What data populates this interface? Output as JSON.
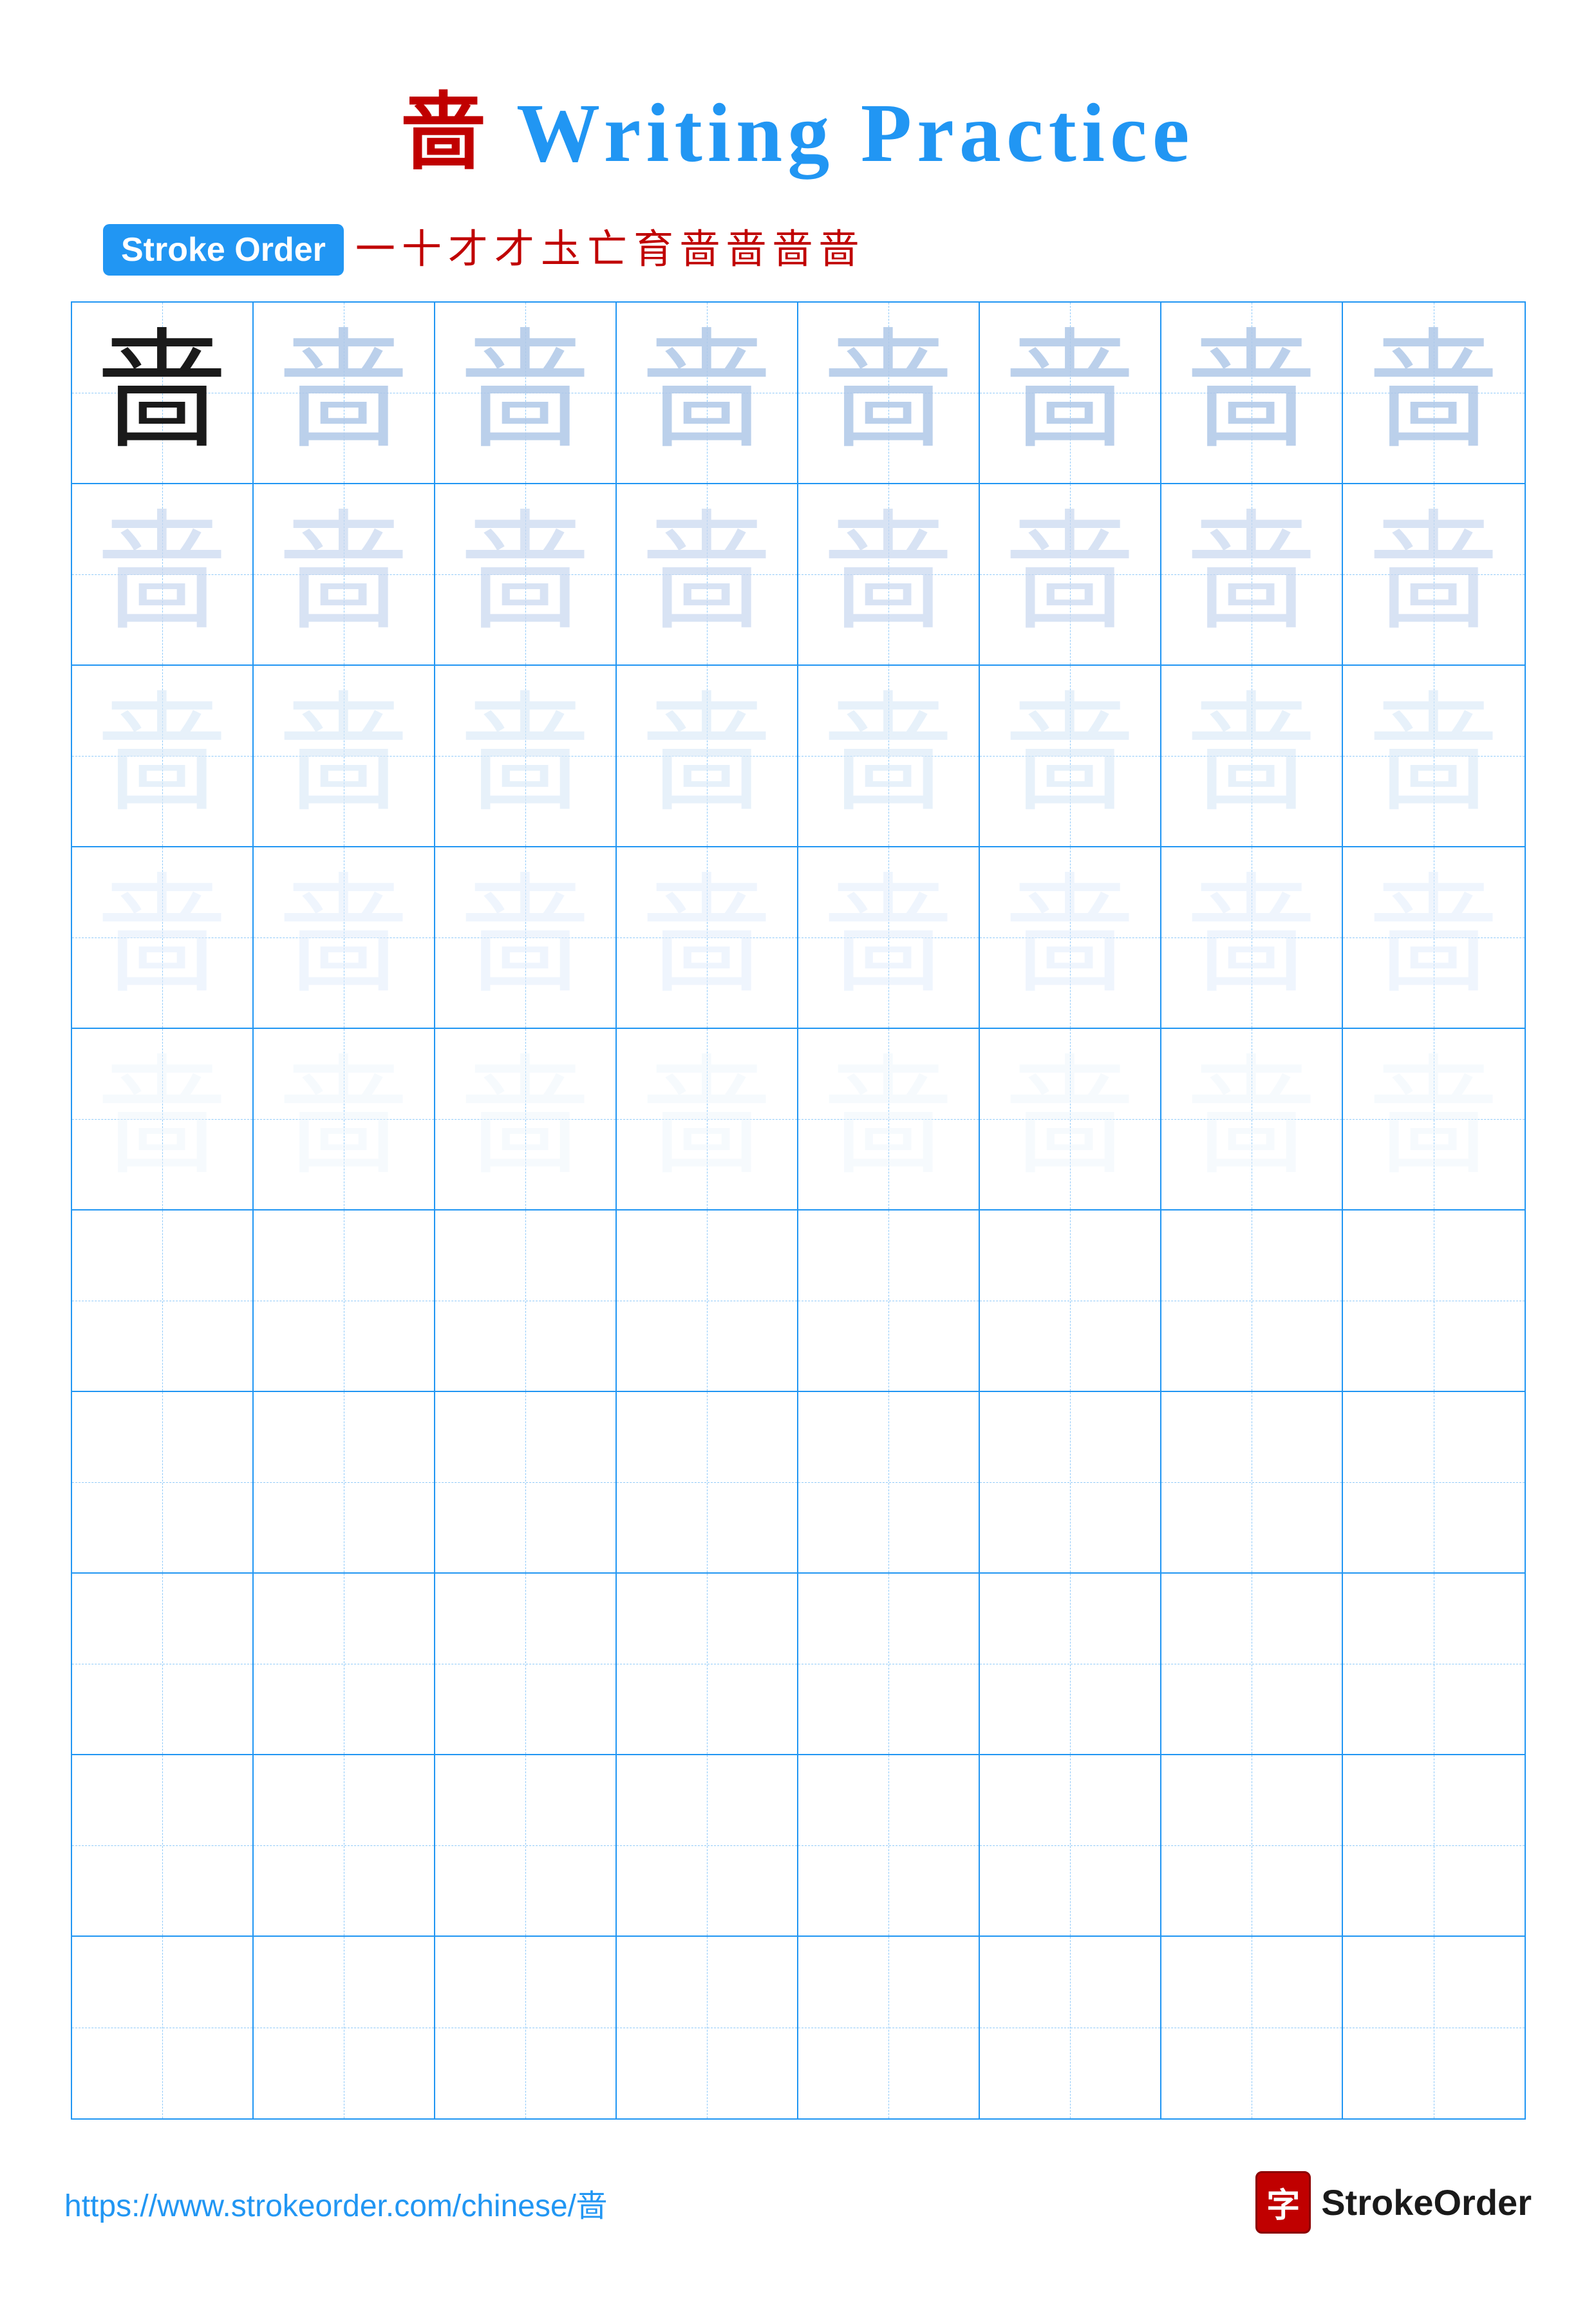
{
  "title": {
    "char": "啬",
    "text": "Writing Practice",
    "full": "啬 Writing Practice"
  },
  "stroke_order": {
    "badge_label": "Stroke Order",
    "steps": [
      "一",
      "十",
      "才",
      "才",
      "圡",
      "亡",
      "育",
      "啬",
      "啬",
      "啬",
      "啬"
    ]
  },
  "grid": {
    "rows": 10,
    "cols": 8,
    "char": "啬",
    "guide_rows": 5
  },
  "footer": {
    "url": "https://www.strokeorder.com/chinese/啬",
    "logo_char": "字",
    "logo_text": "StrokeOrder"
  }
}
